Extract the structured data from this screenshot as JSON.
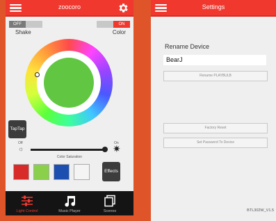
{
  "left_screen": {
    "header": {
      "title": "zoocoro",
      "menu_icon": "menu-icon",
      "settings_icon": "gear-icon"
    },
    "shake": {
      "toggle_text": "OFF",
      "label": "Shake"
    },
    "color": {
      "toggle_text": "ON",
      "label": "Color"
    },
    "color_wheel": {
      "selected_color": "#61c742"
    },
    "taptap_label": "TapTap",
    "brightness": {
      "off_label": "Off",
      "on_label": "On",
      "level": 0.97
    },
    "saturation_label": "Color Saturation",
    "swatches": [
      "#d92a2a",
      "#8ad04a",
      "#1c4fb0",
      "#f4f4f4"
    ],
    "effects_label": "Effects",
    "tabs": [
      {
        "label": "Light Control",
        "icon": "sliders-icon",
        "active": true
      },
      {
        "label": "Music Player",
        "icon": "music-note-icon",
        "active": false
      },
      {
        "label": "Scenes",
        "icon": "scenes-icon",
        "active": false
      }
    ]
  },
  "right_screen": {
    "header": {
      "title": "Settings",
      "menu_icon": "menu-icon"
    },
    "rename_title": "Rename Device",
    "device_name": "BearJ",
    "rename_button": "Rename PLAYBULB",
    "factory_reset_button": "Factory Reset",
    "set_password_button": "Set Password To Device",
    "version": "BTL302W_V1.5"
  },
  "colors": {
    "accent": "#f0382f",
    "background": "#e0542a",
    "bottom_bar": "#141414"
  }
}
